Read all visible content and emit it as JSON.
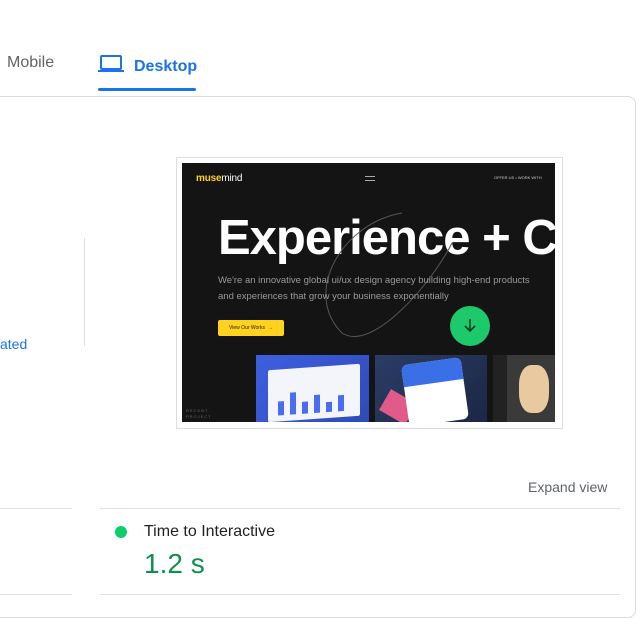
{
  "tabs": {
    "mobile": {
      "label": "Mobile",
      "icon": "mobile-icon"
    },
    "desktop": {
      "label": "Desktop",
      "icon": "laptop-icon",
      "active": true
    }
  },
  "left_panel": {
    "truncated_link": "ated"
  },
  "preview": {
    "site": {
      "logo_part1": "muse",
      "logo_part2": "mind",
      "nav_links": "OFFER US    •  WORK WITH",
      "hero_title": "Experience + C",
      "hero_sub": "We're an innovative global ui/ux design agency building high-end products and experiences that grow your business exponentially",
      "cta_label": "View Our Works",
      "side_text": "RECENT\nPROJECT",
      "accent_color": "#ffd21f",
      "button_color": "#1ec96b"
    }
  },
  "expand_view": "Expand view",
  "metric": {
    "label": "Time to Interactive",
    "value": "1.2 s",
    "status_color": "#0cce6b",
    "value_color": "#0d904f"
  }
}
